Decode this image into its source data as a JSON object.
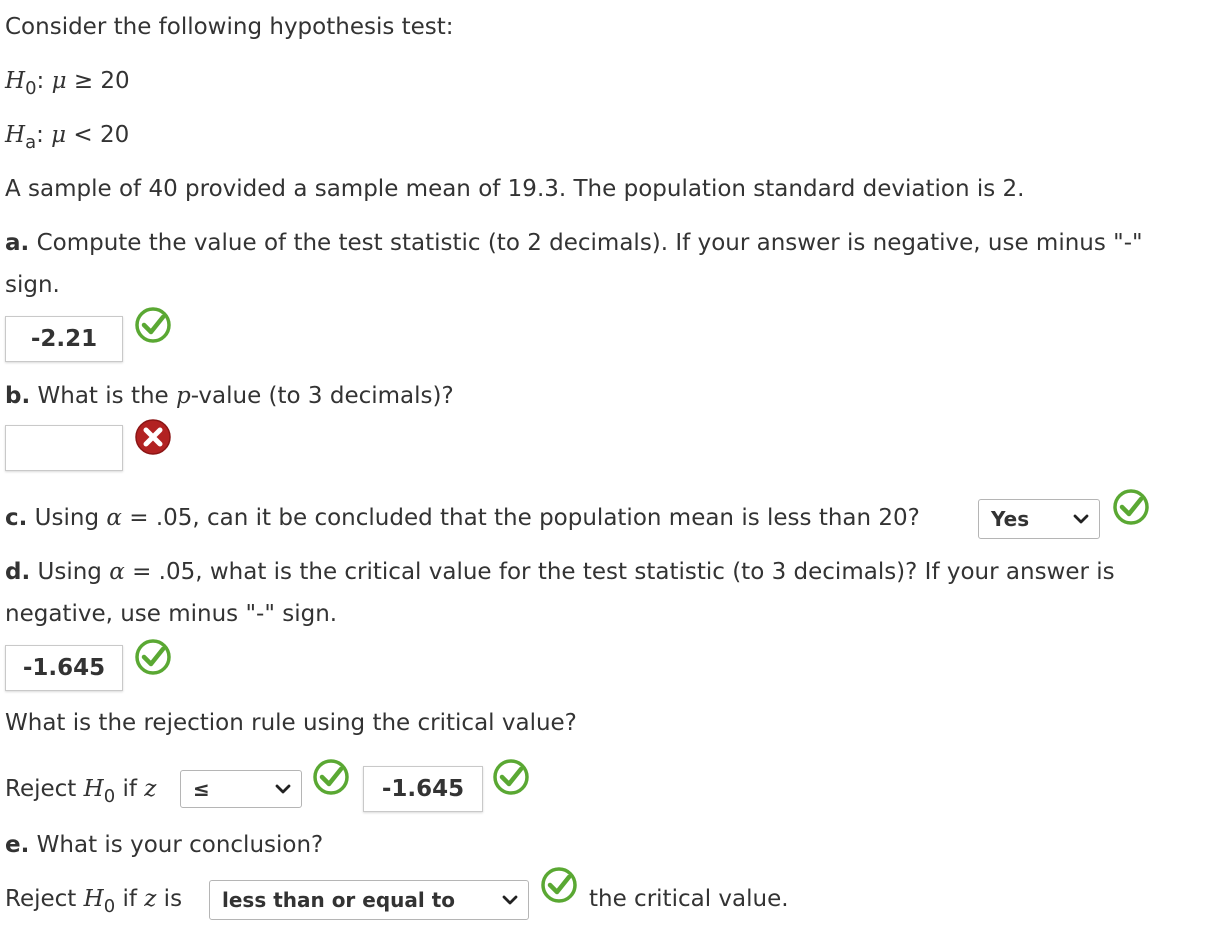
{
  "intro": "Consider the following hypothesis test:",
  "h0": {
    "H": "H",
    "sub": "0",
    "rest": ": ",
    "mu": "μ",
    "rel": " ≥ 20"
  },
  "ha": {
    "H": "H",
    "sub": "a",
    "rest": ": ",
    "mu": "μ",
    "rel": " < 20"
  },
  "sample_text": "A sample of 40 provided a sample mean of 19.3. The population standard deviation is 2.",
  "qa": {
    "label": "a.",
    "text_line1": " Compute the value of the test statistic (to 2 decimals). If your answer is negative, use minus \"-\"",
    "text_line2": "sign.",
    "answer": "-2.21"
  },
  "qb": {
    "label": "b.",
    "pre": " What is the ",
    "p": "p",
    "post": "-value (to 3 decimals)?",
    "answer": ""
  },
  "qc": {
    "label": "c.",
    "pre": " Using ",
    "alpha": "α",
    "post": " = .05, can it be concluded that the population mean is less than 20?",
    "selected": "Yes"
  },
  "qd": {
    "label": "d.",
    "pre": " Using ",
    "alpha": "α",
    "post_line1": " = .05, what is the critical value for the test statistic (to 3 decimals)? If your answer is",
    "line2": "negative, use minus \"-\" sign.",
    "answer": "-1.645"
  },
  "rule_question": "What is the rejection rule using the critical value?",
  "rule": {
    "pre": "Reject ",
    "H": "H",
    "sub": "0",
    "mid": " if ",
    "z": "z",
    "operator": "≤",
    "value": "-1.645"
  },
  "qe": {
    "label": "e.",
    "text": " What is your conclusion?"
  },
  "conclusion": {
    "pre": "Reject ",
    "H": "H",
    "sub": "0",
    "mid": " if ",
    "z": "z",
    "is": " is",
    "selected": "less than or equal to",
    "post": "the critical value."
  },
  "colors": {
    "correct": "#5aa833",
    "incorrect": "#b22222",
    "text": "#333333"
  },
  "icons": {
    "correct": "check-circle-icon",
    "incorrect": "x-circle-icon",
    "dropdown": "chevron-down-icon"
  }
}
